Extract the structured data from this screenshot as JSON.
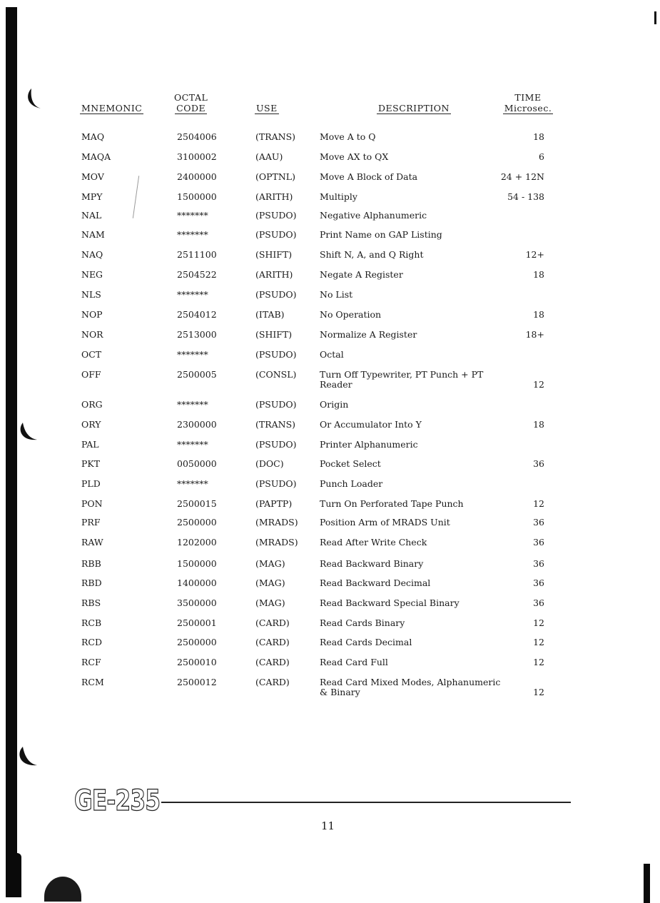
{
  "headers": {
    "mnemonic": "MNEMONIC",
    "octal_code_top": "OCTAL",
    "octal_code_bottom": "CODE",
    "use": "USE",
    "description": "DESCRIPTION",
    "time_top": "TIME",
    "time_bottom": "Microsec."
  },
  "rows": [
    {
      "mnemonic": "MAQ",
      "octal": "2504006",
      "use": "(TRANS)",
      "description": "Move A to Q",
      "description2": "",
      "time": "18"
    },
    {
      "mnemonic": "MAQA",
      "octal": "3100002",
      "use": "(AAU)",
      "description": "Move AX to QX",
      "description2": "",
      "time": "6"
    },
    {
      "mnemonic": "MOV",
      "octal": "2400000",
      "use": "(OPTNL)",
      "description": "Move A Block of Data",
      "description2": "",
      "time": "24 + 12N"
    },
    {
      "mnemonic": "MPY",
      "octal": "1500000",
      "use": "(ARITH)",
      "description": "Multiply",
      "description2": "",
      "time": "54 - 138"
    },
    {
      "mnemonic": "NAL",
      "octal": "*******",
      "use": "(PSUDO)",
      "description": "Negative Alphanumeric",
      "description2": "",
      "time": ""
    },
    {
      "mnemonic": "NAM",
      "octal": "*******",
      "use": "(PSUDO)",
      "description": "Print Name on GAP Listing",
      "description2": "",
      "time": ""
    },
    {
      "mnemonic": "NAQ",
      "octal": "2511100",
      "use": "(SHIFT)",
      "description": "Shift N, A, and Q Right",
      "description2": "",
      "time": "12+"
    },
    {
      "mnemonic": "NEG",
      "octal": "2504522",
      "use": "(ARITH)",
      "description": "Negate A Register",
      "description2": "",
      "time": "18"
    },
    {
      "mnemonic": "NLS",
      "octal": "*******",
      "use": "(PSUDO)",
      "description": "No List",
      "description2": "",
      "time": ""
    },
    {
      "mnemonic": "NOP",
      "octal": "2504012",
      "use": "(ITAB)",
      "description": "No Operation",
      "description2": "",
      "time": "18"
    },
    {
      "mnemonic": "NOR",
      "octal": "2513000",
      "use": "(SHIFT)",
      "description": "Normalize A Register",
      "description2": "",
      "time": "18+"
    },
    {
      "mnemonic": "OCT",
      "octal": "*******",
      "use": "(PSUDO)",
      "description": "Octal",
      "description2": "",
      "time": ""
    },
    {
      "mnemonic": "OFF",
      "octal": "2500005",
      "use": "(CONSL)",
      "description": "Turn Off Typewriter, PT Punch + PT",
      "description2": "Reader",
      "time": "12"
    },
    {
      "mnemonic": "ORG",
      "octal": "*******",
      "use": "(PSUDO)",
      "description": "Origin",
      "description2": "",
      "time": ""
    },
    {
      "mnemonic": "ORY",
      "octal": "2300000",
      "use": "(TRANS)",
      "description": "Or Accumulator Into Y",
      "description2": "",
      "time": "18"
    },
    {
      "mnemonic": "PAL",
      "octal": "*******",
      "use": "(PSUDO)",
      "description": "Printer Alphanumeric",
      "description2": "",
      "time": ""
    },
    {
      "mnemonic": "PKT",
      "octal": "0050000",
      "use": "(DOC)",
      "description": "Pocket Select",
      "description2": "",
      "time": "36"
    },
    {
      "mnemonic": "PLD",
      "octal": "*******",
      "use": "(PSUDO)",
      "description": "Punch Loader",
      "description2": "",
      "time": ""
    },
    {
      "mnemonic": "PON",
      "octal": "2500015",
      "use": "(PAPTP)",
      "description": "Turn On Perforated Tape Punch",
      "description2": "",
      "time": "12"
    },
    {
      "mnemonic": "PRF",
      "octal": "2500000",
      "use": "(MRADS)",
      "description": "Position Arm of MRADS Unit",
      "description2": "",
      "time": "36"
    },
    {
      "mnemonic": "RAW",
      "octal": "1202000",
      "use": "(MRADS)",
      "description": "Read After Write Check",
      "description2": "",
      "time": "36"
    },
    {
      "mnemonic": "RBB",
      "octal": "1500000",
      "use": "(MAG)",
      "description": "Read Backward Binary",
      "description2": "",
      "time": "36"
    },
    {
      "mnemonic": "RBD",
      "octal": "1400000",
      "use": "(MAG)",
      "description": "Read Backward Decimal",
      "description2": "",
      "time": "36"
    },
    {
      "mnemonic": "RBS",
      "octal": "3500000",
      "use": "(MAG)",
      "description": "Read Backward Special Binary",
      "description2": "",
      "time": "36"
    },
    {
      "mnemonic": "RCB",
      "octal": "2500001",
      "use": "(CARD)",
      "description": "Read Cards Binary",
      "description2": "",
      "time": "12"
    },
    {
      "mnemonic": "RCD",
      "octal": "2500000",
      "use": "(CARD)",
      "description": "Read Cards Decimal",
      "description2": "",
      "time": "12"
    },
    {
      "mnemonic": "RCF",
      "octal": "2500010",
      "use": "(CARD)",
      "description": "Read Card Full",
      "description2": "",
      "time": "12"
    },
    {
      "mnemonic": "RCM",
      "octal": "2500012",
      "use": "(CARD)",
      "description": "Read Card Mixed Modes, Alphanumeric",
      "description2": "& Binary",
      "time": "12"
    }
  ],
  "footer": {
    "logo": "GE-235",
    "page_number": "11"
  }
}
